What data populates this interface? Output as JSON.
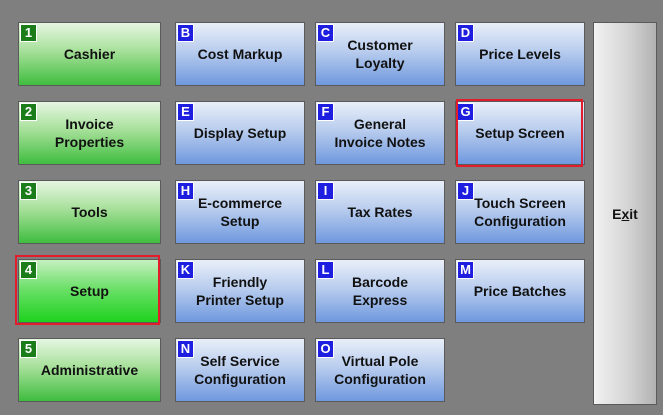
{
  "green_column": [
    {
      "badge": "1",
      "label": "Cashier",
      "name": "cashier-button"
    },
    {
      "badge": "2",
      "label": "Invoice\nProperties",
      "name": "invoice-properties-button"
    },
    {
      "badge": "3",
      "label": "Tools",
      "name": "tools-button"
    },
    {
      "badge": "4",
      "label": "Setup",
      "name": "setup-button"
    },
    {
      "badge": "5",
      "label": "Administrative",
      "name": "administrative-button"
    }
  ],
  "blue_grid": [
    {
      "badge": "B",
      "label": "Cost Markup"
    },
    {
      "badge": "C",
      "label": "Customer\nLoyalty"
    },
    {
      "badge": "D",
      "label": "Price Levels"
    },
    {
      "badge": "E",
      "label": "Display Setup"
    },
    {
      "badge": "F",
      "label": "General\nInvoice Notes"
    },
    {
      "badge": "G",
      "label": "Setup Screen"
    },
    {
      "badge": "H",
      "label": "E-commerce\nSetup"
    },
    {
      "badge": "I",
      "label": "Tax Rates"
    },
    {
      "badge": "J",
      "label": "Touch Screen\nConfiguration"
    },
    {
      "badge": "K",
      "label": "Friendly\nPrinter Setup"
    },
    {
      "badge": "L",
      "label": "Barcode\nExpress"
    },
    {
      "badge": "M",
      "label": "Price Batches"
    },
    {
      "badge": "N",
      "label": "Self Service\nConfiguration"
    },
    {
      "badge": "O",
      "label": "Virtual Pole\nConfiguration"
    }
  ],
  "exit": {
    "label": "Exit",
    "mnemonic": "x"
  },
  "colors": {
    "badge_green": "#1a7d1a",
    "badge_blue": "#1e1ee0",
    "highlight": "#e21c2a",
    "background": "#7f7f7f"
  }
}
